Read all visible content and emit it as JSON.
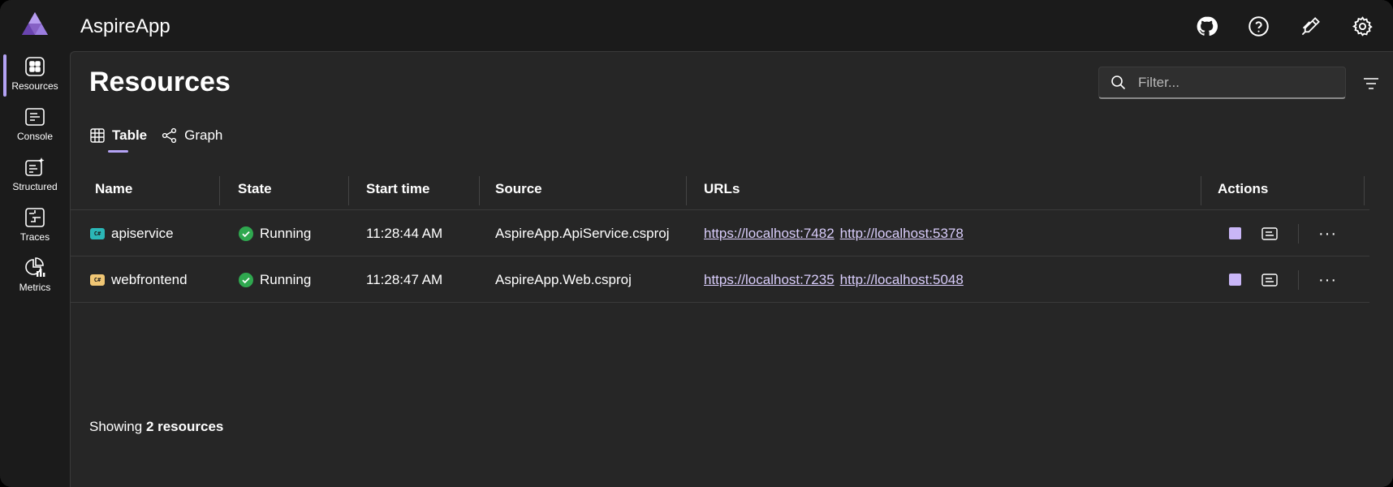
{
  "app": {
    "title": "AspireApp"
  },
  "header": {
    "icons": [
      "github-icon",
      "help-icon",
      "dev-docs-icon",
      "settings-icon"
    ]
  },
  "sidenav": {
    "items": [
      {
        "label": "Resources",
        "icon": "resources-icon",
        "active": true
      },
      {
        "label": "Console",
        "icon": "console-icon",
        "active": false
      },
      {
        "label": "Structured",
        "icon": "structured-icon",
        "active": false
      },
      {
        "label": "Traces",
        "icon": "traces-icon",
        "active": false
      },
      {
        "label": "Metrics",
        "icon": "metrics-icon",
        "active": false
      }
    ]
  },
  "page": {
    "title": "Resources",
    "filter_placeholder": "Filter...",
    "tabs": [
      {
        "label": "Table",
        "icon": "table-icon",
        "active": true
      },
      {
        "label": "Graph",
        "icon": "graph-icon",
        "active": false
      }
    ]
  },
  "table": {
    "columns": [
      "Name",
      "State",
      "Start time",
      "Source",
      "URLs",
      "Actions"
    ],
    "rows": [
      {
        "name": "apiservice",
        "icon_color": "#2bb7b7",
        "state": "Running",
        "start_time": "11:28:44 AM",
        "source": "AspireApp.ApiService.csproj",
        "urls": [
          "https://localhost:7482",
          "http://localhost:5378"
        ]
      },
      {
        "name": "webfrontend",
        "icon_color": "#f0c674",
        "state": "Running",
        "start_time": "11:28:47 AM",
        "source": "AspireApp.Web.csproj",
        "urls": [
          "https://localhost:7235",
          "http://localhost:5048"
        ]
      }
    ]
  },
  "footer": {
    "prefix": "Showing ",
    "count": "2 resources"
  },
  "colors": {
    "accent": "#b4a3f5",
    "running": "#2fa84f",
    "link": "#d9cdfb"
  }
}
